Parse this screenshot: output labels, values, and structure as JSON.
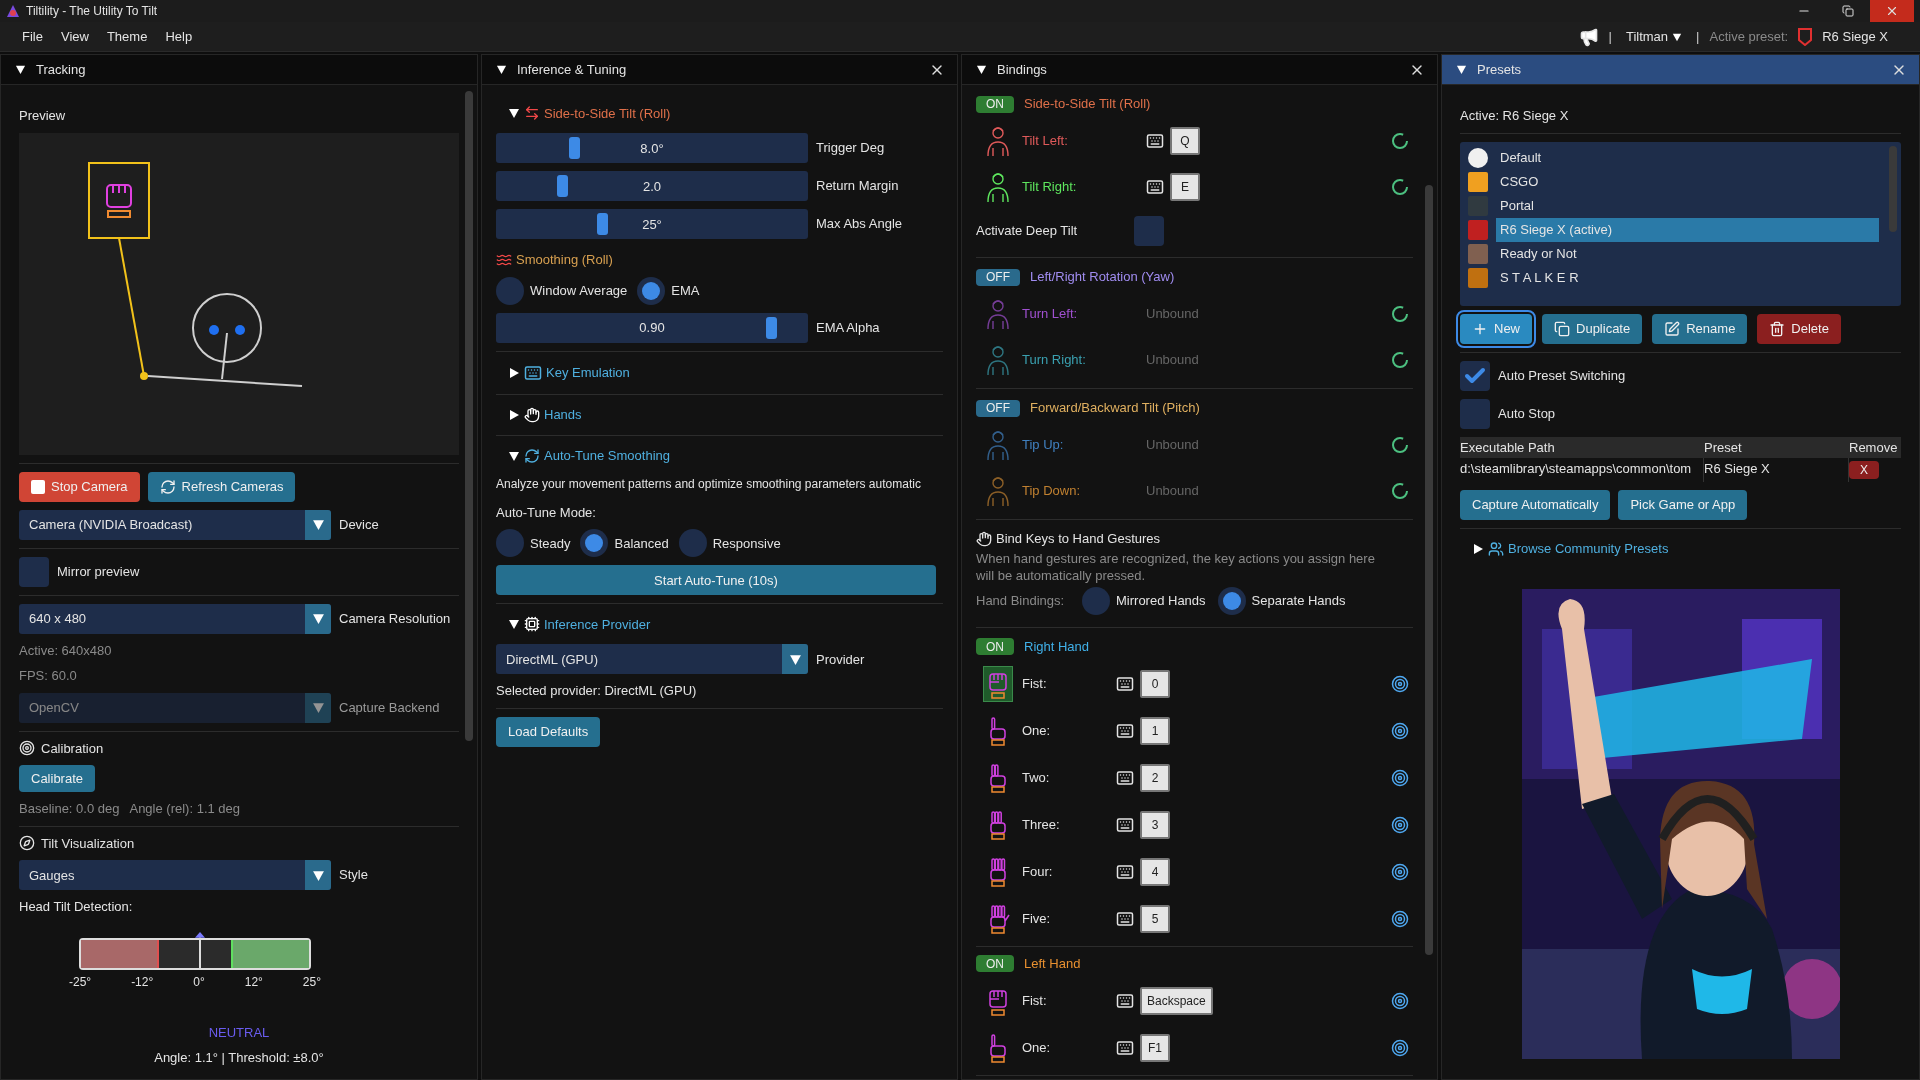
{
  "window": {
    "title": "Tiltility - The Utility To Tilt"
  },
  "menu": [
    "File",
    "View",
    "Theme",
    "Help"
  ],
  "topbar": {
    "separators": [
      "|",
      "|"
    ],
    "user": "Tiltman",
    "active_label": "Active preset:",
    "active_preset": "R6 Siege X"
  },
  "panels": [
    {
      "title": "Tracking",
      "selected": false,
      "closable": false
    },
    {
      "title": "Inference & Tuning",
      "selected": false,
      "closable": true
    },
    {
      "title": "Bindings",
      "selected": false,
      "closable": true
    },
    {
      "title": "Presets",
      "selected": true,
      "closable": true
    }
  ],
  "tracking": {
    "preview_label": "Preview",
    "stop_button": "Stop Camera",
    "refresh_button": "Refresh Cameras",
    "device": {
      "value": "Camera (NVIDIA Broadcast)",
      "label": "Device",
      "disabled": false
    },
    "mirror": {
      "label": "Mirror preview",
      "checked": false
    },
    "resolution": {
      "value": "640 x 480",
      "label": "Camera Resolution",
      "disabled": false
    },
    "active": "Active: 640x480",
    "fps": "FPS: 60.0",
    "backend": {
      "value": "OpenCV",
      "label": "Capture Backend",
      "disabled": true
    },
    "calibration": {
      "title": "Calibration",
      "button": "Calibrate",
      "baseline": "Baseline: 0.0 deg",
      "angle": "Angle (rel): 1.1 deg"
    },
    "visualization": {
      "title": "Tilt Visualization",
      "style": {
        "value": "Gauges",
        "label": "Style",
        "disabled": false
      }
    },
    "gauge": {
      "title": "Head Tilt Detection:",
      "ticks": [
        "-25°",
        "-12°",
        "0°",
        "12°",
        "25°"
      ],
      "level": 0.522,
      "status": "NEUTRAL",
      "reading": "Angle: 1.1° | Threshold: ±8.0°"
    }
  },
  "inference": {
    "roll": {
      "title": "Side-to-Side Tilt (Roll)",
      "expanded": true,
      "sliders": [
        {
          "value": "8.0°",
          "label": "Trigger Deg",
          "level": 0.25
        },
        {
          "value": "2.0",
          "label": "Return Margin",
          "level": 0.21
        },
        {
          "value": "25°",
          "label": "Max Abs Angle",
          "level": 0.34
        }
      ]
    },
    "smoothing": {
      "title": "Smoothing (Roll)",
      "options": [
        {
          "label": "Window Average",
          "selected": false
        },
        {
          "label": "EMA",
          "selected": true
        }
      ],
      "slider": {
        "value": "0.90",
        "label": "EMA Alpha",
        "level": 0.88
      }
    },
    "key_emulation": {
      "title": "Key Emulation",
      "expanded": false
    },
    "hands": {
      "title": "Hands",
      "expanded": false
    },
    "autotune": {
      "title": "Auto-Tune Smoothing",
      "expanded": true,
      "description": "Analyze your movement patterns and optimize smoothing parameters automatic",
      "mode_label": "Auto-Tune Mode:",
      "modes": [
        {
          "label": "Steady",
          "selected": false
        },
        {
          "label": "Balanced",
          "selected": true
        },
        {
          "label": "Responsive",
          "selected": false
        }
      ],
      "button": "Start Auto-Tune (10s)"
    },
    "provider": {
      "title": "Inference Provider",
      "expanded": true,
      "dropdown": {
        "value": "DirectML (GPU)",
        "label": "Provider",
        "disabled": false
      },
      "selected_text": "Selected provider: DirectML (GPU)",
      "button": "Load Defaults"
    }
  },
  "bindings": {
    "groups": [
      {
        "toggle": "ON",
        "on": true,
        "title": "Side-to-Side Tilt (Roll)",
        "color": "#e0704a",
        "rows": [
          {
            "kind": "key",
            "label": "Tilt Left:",
            "key": "Q",
            "color": "#e05a5a"
          },
          {
            "kind": "key",
            "label": "Tilt Right:",
            "key": "E",
            "color": "#5ee65e"
          }
        ],
        "option": {
          "label": "Activate Deep Tilt",
          "checked": false
        }
      },
      {
        "toggle": "OFF",
        "on": false,
        "title": "Left/Right Rotation (Yaw)",
        "color": "#a08cf0",
        "rows": [
          {
            "kind": "unbound",
            "label": "Turn Left:",
            "value": "Unbound",
            "color": "#a050d0"
          },
          {
            "kind": "unbound",
            "label": "Turn Right:",
            "value": "Unbound",
            "color": "#3aa0b0"
          }
        ]
      },
      {
        "toggle": "OFF",
        "on": false,
        "title": "Forward/Backward Tilt (Pitch)",
        "color": "#e0b060",
        "rows": [
          {
            "kind": "unbound",
            "label": "Tip Up:",
            "value": "Unbound",
            "color": "#4080c0"
          },
          {
            "kind": "unbound",
            "label": "Tip Down:",
            "value": "Unbound",
            "color": "#c08030"
          }
        ]
      }
    ],
    "hands": {
      "title": "Bind Keys to Hand Gestures",
      "description": "When hand gestures are recognized, the key actions you assign here will be automatically pressed.",
      "mode_label": "Hand Bindings:",
      "modes": [
        {
          "label": "Mirrored Hands",
          "selected": false
        },
        {
          "label": "Separate Hands",
          "selected": true
        }
      ]
    },
    "hand_groups": [
      {
        "toggle": "ON",
        "on": true,
        "title": "Right Hand",
        "color": "#40b0e8",
        "rows": [
          {
            "label": "Fist:",
            "key": "0",
            "selected": true
          },
          {
            "label": "One:",
            "key": "1",
            "selected": false
          },
          {
            "label": "Two:",
            "key": "2",
            "selected": false
          },
          {
            "label": "Three:",
            "key": "3",
            "selected": false
          },
          {
            "label": "Four:",
            "key": "4",
            "selected": false
          },
          {
            "label": "Five:",
            "key": "5",
            "selected": false
          }
        ]
      },
      {
        "toggle": "ON",
        "on": true,
        "title": "Left Hand",
        "color": "#e89030",
        "rows": [
          {
            "label": "Fist:",
            "key": "Backspace",
            "selected": false
          },
          {
            "label": "One:",
            "key": "F1",
            "selected": false
          }
        ]
      }
    ]
  },
  "presets": {
    "active": "Active: R6 Siege X",
    "items": [
      {
        "name": "Default",
        "selected": false
      },
      {
        "name": "CSGO",
        "selected": false
      },
      {
        "name": "Portal",
        "selected": false
      },
      {
        "name": "R6 Siege X  (active)",
        "selected": true
      },
      {
        "name": "Ready or Not",
        "selected": false
      },
      {
        "name": "S T A L K E R",
        "selected": false
      }
    ],
    "buttons": [
      {
        "label": "New",
        "kind": "new",
        "focused": true
      },
      {
        "label": "Duplicate",
        "kind": "duplicate",
        "focused": false
      },
      {
        "label": "Rename",
        "kind": "rename",
        "focused": false
      },
      {
        "label": "Delete",
        "kind": "delete",
        "focused": false
      }
    ],
    "checkboxes": [
      {
        "label": "Auto Preset Switching",
        "checked": true
      },
      {
        "label": "Auto Stop",
        "checked": false
      }
    ],
    "table": {
      "columns": [
        "Executable Path",
        "Preset",
        "Remove"
      ],
      "rows": [
        [
          "d:\\steamlibrary\\steamapps\\common\\tom",
          "R6 Siege X",
          "X"
        ]
      ]
    },
    "actions": [
      "Capture Automatically",
      "Pick Game or App"
    ],
    "community": {
      "title": "Browse Community Presets",
      "expanded": false
    }
  }
}
